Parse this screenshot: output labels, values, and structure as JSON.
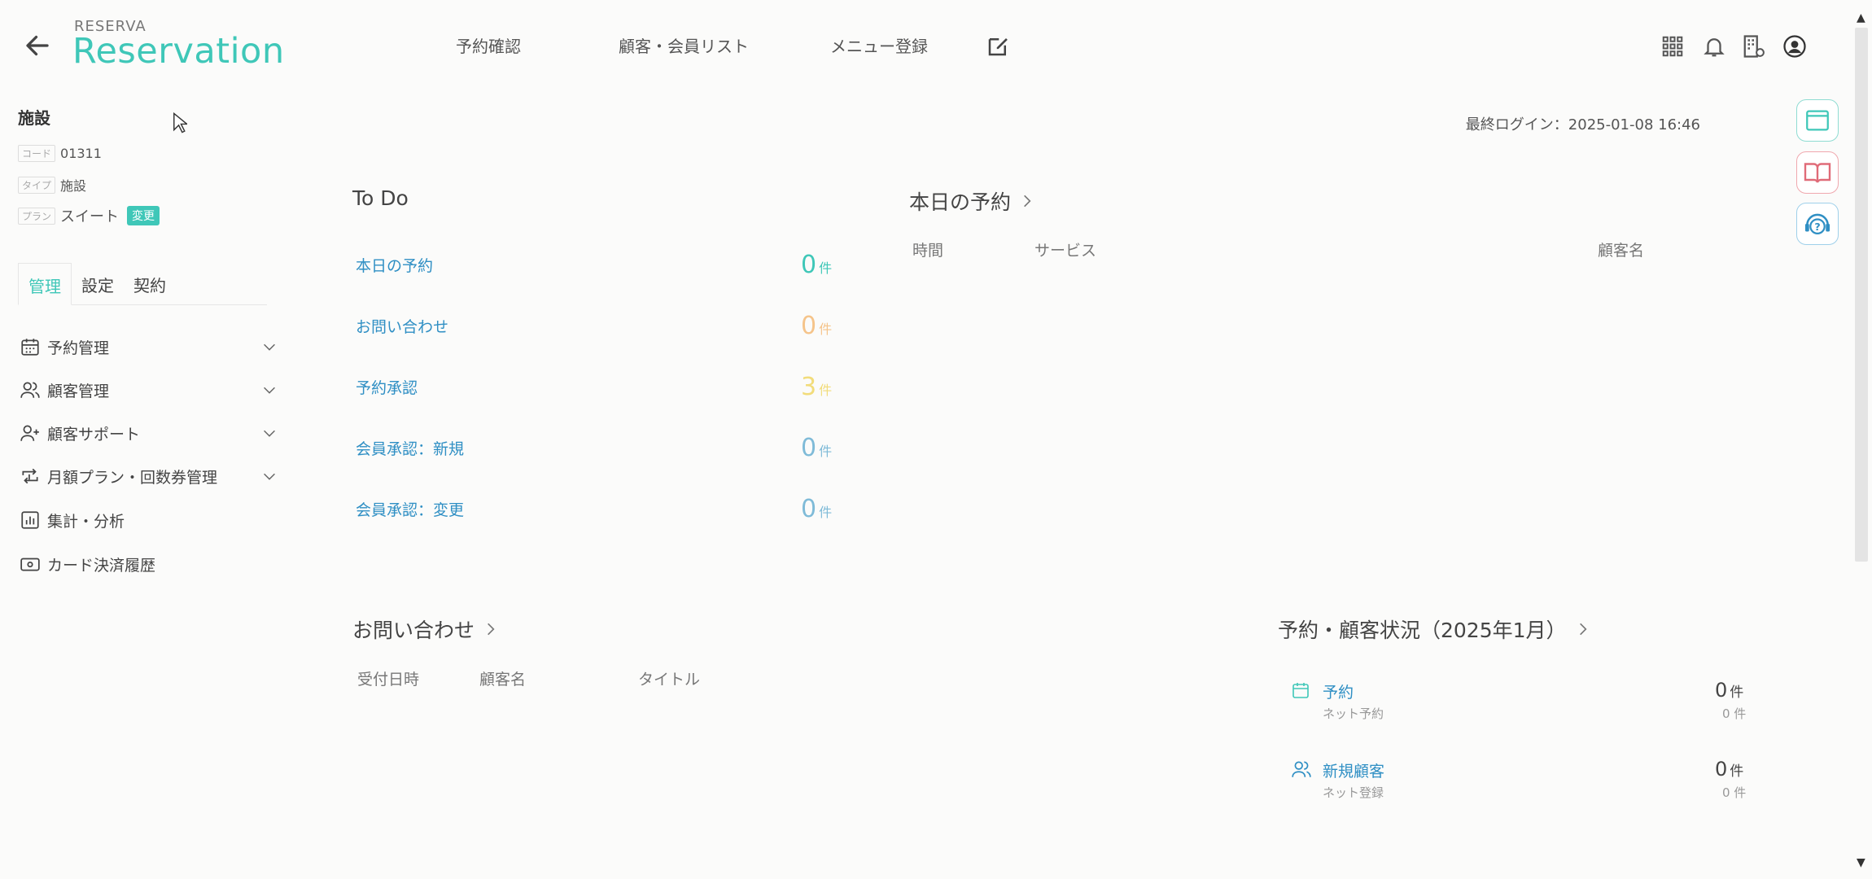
{
  "header": {
    "logo_top": "RESERVA",
    "logo_main": "Reservation",
    "nav": [
      "予約確認",
      "顧客・会員リスト",
      "メニュー登録"
    ]
  },
  "facility": {
    "title": "施設",
    "code_tag": "コード",
    "code": "01311",
    "type_tag": "タイプ",
    "type": "施設",
    "plan_tag": "プラン",
    "plan": "スイート",
    "change_label": "変更"
  },
  "tabs": [
    "管理",
    "設定",
    "契約"
  ],
  "menu": [
    {
      "label": "予約管理",
      "icon": "calendar-icon"
    },
    {
      "label": "顧客管理",
      "icon": "users-icon"
    },
    {
      "label": "顧客サポート",
      "icon": "user-plus-icon"
    },
    {
      "label": "月額プラン・回数券管理",
      "icon": "repeat-icon"
    },
    {
      "label": "集計・分析",
      "icon": "bar-chart-icon"
    },
    {
      "label": "カード決済履歴",
      "icon": "card-icon"
    }
  ],
  "last_login": "最終ログイン：2025-01-08 16:46",
  "todo": {
    "title": "To Do",
    "unit": "件",
    "items": [
      {
        "label": "本日の予約",
        "value": "0",
        "color": "#3fc7b8"
      },
      {
        "label": "お問い合わせ",
        "value": "0",
        "color": "#f5c48a"
      },
      {
        "label": "予約承認",
        "value": "3",
        "color": "#f2dc7a"
      },
      {
        "label": "会員承認：新規",
        "value": "0",
        "color": "#7fbbd8"
      },
      {
        "label": "会員承認：変更",
        "value": "0",
        "color": "#7fbbd8"
      }
    ]
  },
  "today": {
    "title": "本日の予約",
    "columns": [
      "時間",
      "サービス",
      "顧客名"
    ]
  },
  "inquiry": {
    "title": "お問い合わせ",
    "columns": [
      "受付日時",
      "顧客名",
      "タイトル"
    ]
  },
  "status": {
    "title": "予約・顧客状況（2025年1月）",
    "items": [
      {
        "label": "予約",
        "sub": "ネット予約",
        "value": "0",
        "unit": "件",
        "sub_value": "0 件"
      },
      {
        "label": "新規顧客",
        "sub": "ネット登録",
        "value": "0",
        "unit": "件",
        "sub_value": "0 件"
      }
    ]
  }
}
